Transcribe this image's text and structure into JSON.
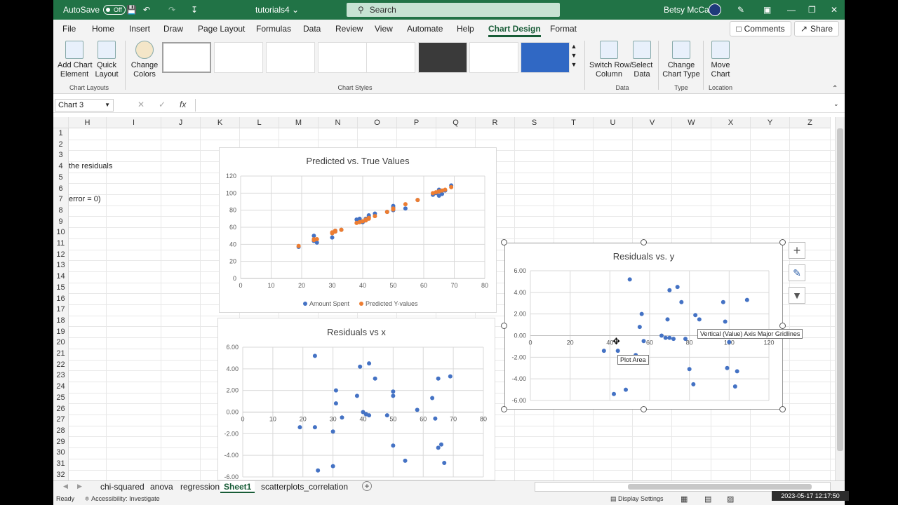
{
  "titlebar": {
    "autosave_label": "AutoSave",
    "autosave_state": "Off",
    "filename": "tutorials4",
    "search_placeholder": "Search",
    "user": "Betsy McCall"
  },
  "menu": {
    "items": [
      "File",
      "Home",
      "Insert",
      "Draw",
      "Page Layout",
      "Formulas",
      "Data",
      "Review",
      "View",
      "Automate",
      "Help",
      "Chart Design",
      "Format"
    ],
    "active": "Chart Design",
    "comments": "Comments",
    "share": "Share"
  },
  "ribbon": {
    "add_chart_element": "Add Chart\nElement",
    "quick_layout": "Quick\nLayout",
    "change_colors": "Change\nColors",
    "switch_row_column": "Switch Row/\nColumn",
    "select_data": "Select\nData",
    "change_chart_type": "Change\nChart Type",
    "move_chart": "Move\nChart",
    "group_chart_layouts": "Chart Layouts",
    "group_chart_styles": "Chart Styles",
    "group_data": "Data",
    "group_type": "Type",
    "group_location": "Location"
  },
  "formula_bar": {
    "name_box": "Chart 3",
    "fx": "fx"
  },
  "sheet": {
    "columns": [
      "H",
      "I",
      "J",
      "K",
      "L",
      "M",
      "N",
      "O",
      "P",
      "Q",
      "R",
      "S",
      "T",
      "U",
      "V",
      "W",
      "X",
      "Y",
      "Z"
    ],
    "rows": [
      "1",
      "2",
      "3",
      "4",
      "5",
      "6",
      "7",
      "8",
      "9",
      "10",
      "11",
      "12",
      "13",
      "14",
      "15",
      "16",
      "17",
      "18",
      "19",
      "20",
      "21",
      "22",
      "23",
      "24",
      "25",
      "26",
      "27",
      "28",
      "29",
      "30",
      "31",
      "32"
    ],
    "cell_h4": "the residuals",
    "cell_h7": "error = 0)"
  },
  "chart_data": [
    {
      "type": "scatter",
      "title": "Predicted vs. True Values",
      "xlim": [
        0,
        80
      ],
      "ylim": [
        0,
        120
      ],
      "xticks": [
        "0",
        "10",
        "20",
        "30",
        "40",
        "50",
        "60",
        "70",
        "80"
      ],
      "yticks": [
        "0",
        "20",
        "40",
        "60",
        "80",
        "100",
        "120"
      ],
      "legend_position": "bottom",
      "series": [
        {
          "name": "Amount Spent",
          "color": "#4472c4",
          "x": [
            19,
            24,
            24,
            25,
            30,
            30,
            31,
            31,
            33,
            38,
            39,
            40,
            41,
            41,
            42,
            42,
            44,
            48,
            50,
            50,
            50,
            54,
            58,
            63,
            64,
            65,
            65,
            66,
            67,
            69
          ],
          "y": [
            37,
            50,
            44,
            42,
            48,
            53,
            56,
            55,
            57,
            69,
            70,
            66,
            70,
            68,
            74,
            72,
            76,
            78,
            83,
            85,
            80,
            82,
            92,
            98,
            100,
            104,
            97,
            99,
            103,
            109
          ]
        },
        {
          "name": "Predicted Y-values",
          "color": "#ed7d31",
          "x": [
            19,
            24,
            24,
            25,
            30,
            30,
            31,
            31,
            33,
            38,
            39,
            40,
            41,
            41,
            42,
            42,
            44,
            48,
            50,
            50,
            50,
            54,
            58,
            63,
            64,
            65,
            65,
            66,
            67,
            69
          ],
          "y": [
            38,
            45,
            46,
            46,
            53,
            54,
            55,
            56,
            57,
            65,
            66,
            67,
            68,
            69,
            70,
            71,
            73,
            78,
            81,
            81,
            82,
            87,
            92,
            100,
            101,
            102,
            102,
            103,
            104,
            107
          ]
        }
      ]
    },
    {
      "type": "scatter",
      "title": "Residuals vs x",
      "xlim": [
        0,
        80
      ],
      "ylim": [
        -6,
        6
      ],
      "xticks": [
        "0",
        "10",
        "20",
        "30",
        "40",
        "50",
        "60",
        "70",
        "80"
      ],
      "yticks": [
        "-6.00",
        "-4.00",
        "-2.00",
        "0.00",
        "2.00",
        "4.00",
        "6.00"
      ],
      "series": [
        {
          "name": "",
          "color": "#4472c4",
          "x": [
            19,
            24,
            24,
            25,
            30,
            30,
            31,
            31,
            33,
            38,
            39,
            40,
            41,
            41,
            42,
            42,
            44,
            48,
            50,
            50,
            50,
            54,
            58,
            63,
            64,
            65,
            65,
            66,
            67,
            69
          ],
          "y": [
            -1.4,
            5.2,
            -1.4,
            -5.4,
            -5.0,
            -1.8,
            2.0,
            0.8,
            -0.5,
            1.5,
            4.2,
            0.0,
            -0.2,
            -0.2,
            4.5,
            -0.3,
            3.1,
            -0.3,
            1.9,
            1.5,
            -3.1,
            -4.5,
            0.2,
            1.3,
            -0.6,
            -3.3,
            3.1,
            -3.0,
            -4.7,
            3.3
          ]
        }
      ]
    },
    {
      "type": "scatter",
      "title": "Residuals vs. y",
      "xlim": [
        0,
        120
      ],
      "ylim": [
        -6,
        6
      ],
      "xticks": [
        "0",
        "20",
        "40",
        "60",
        "80",
        "100",
        "120"
      ],
      "yticks": [
        "-6.00",
        "-4.00",
        "-2.00",
        "0.00",
        "2.00",
        "4.00",
        "6.00"
      ],
      "series": [
        {
          "name": "",
          "color": "#4472c4",
          "x": [
            37,
            50,
            44,
            42,
            48,
            53,
            56,
            55,
            57,
            69,
            70,
            66,
            70,
            68,
            74,
            72,
            76,
            78,
            83,
            85,
            80,
            82,
            92,
            98,
            100,
            104,
            97,
            99,
            103,
            109
          ],
          "y": [
            -1.4,
            5.2,
            -1.4,
            -5.4,
            -5.0,
            -1.8,
            2.0,
            0.8,
            -0.5,
            1.5,
            4.2,
            0.0,
            -0.2,
            -0.2,
            4.5,
            -0.3,
            3.1,
            -0.3,
            1.9,
            1.5,
            -3.1,
            -4.5,
            0.2,
            1.3,
            -0.6,
            -3.3,
            3.1,
            -3.0,
            -4.7,
            3.3
          ]
        }
      ]
    }
  ],
  "tooltips": {
    "plot_area": "Plot Area",
    "gridlines": "Vertical (Value) Axis Major Gridlines"
  },
  "tabs": [
    "chi-squared",
    "anova",
    "regression",
    "Sheet1",
    "scatterplots_correlation"
  ],
  "active_tab": "Sheet1",
  "status": {
    "ready": "Ready",
    "accessibility": "Accessibility: Investigate",
    "display_settings": "Display Settings",
    "timestamp": "2023-05-17 12:17:50"
  }
}
